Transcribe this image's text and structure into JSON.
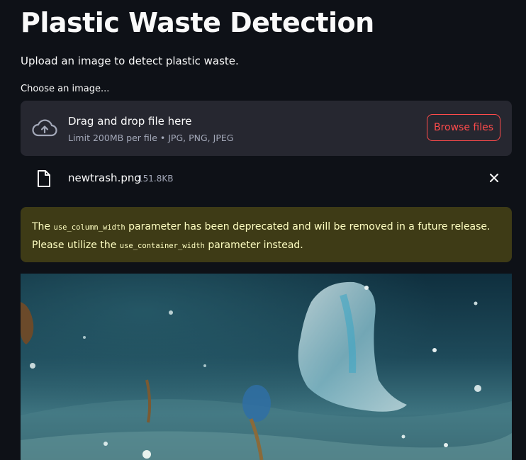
{
  "page": {
    "title": "Plastic Waste Detection",
    "subtitle": "Upload an image to detect plastic waste."
  },
  "uploader": {
    "label": "Choose an image...",
    "drop_title": "Drag and drop file here",
    "limit_text": "Limit 200MB per file • JPG, PNG, JPEG",
    "browse_label": "Browse files",
    "icon": "cloud-upload-icon"
  },
  "uploaded_file": {
    "name": "newtrash.png",
    "size": "151.8KB",
    "icon": "file-icon",
    "remove_icon": "close-icon"
  },
  "warning": {
    "prefix": "The ",
    "param1": "use_column_width",
    "middle": " parameter has been deprecated and will be removed in a future release. Please utilize the ",
    "param2": "use_container_width",
    "suffix": " parameter instead."
  },
  "colors": {
    "background": "#0e1117",
    "panel": "#262730",
    "accent": "#ff4b4b",
    "warning_bg": "#3e3b16",
    "warning_text": "#ffffc2"
  }
}
